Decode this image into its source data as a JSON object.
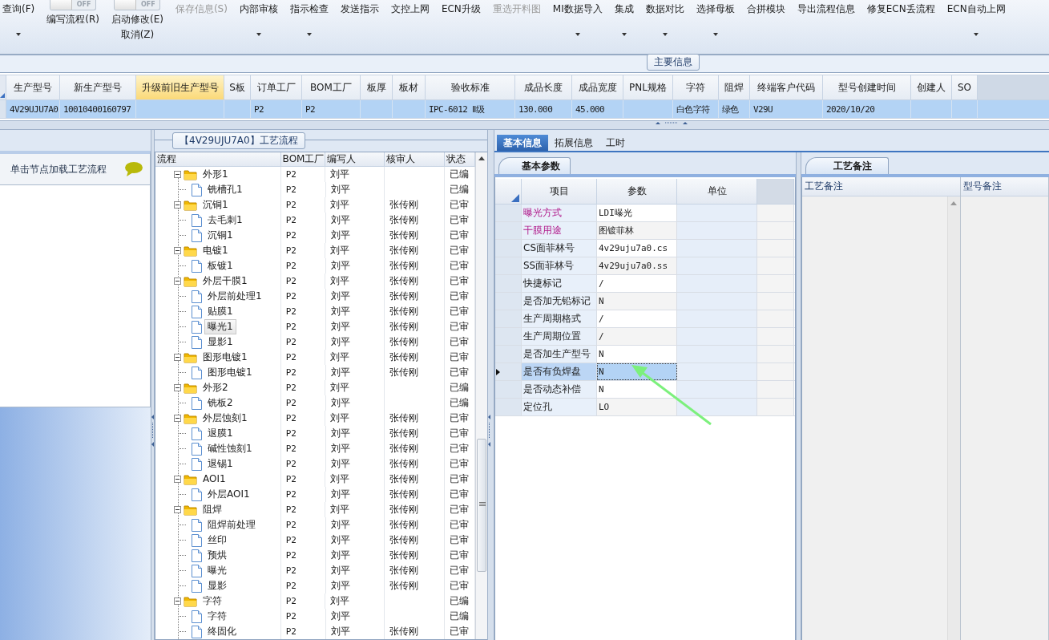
{
  "toolbar": [
    {
      "kind": "button",
      "label": "查询(F)",
      "dropdown": true,
      "disabled": false
    },
    {
      "kind": "toggle",
      "label": "编写流程(R)",
      "switch": "OFF",
      "on": false
    },
    {
      "kind": "toggle",
      "label": "启动修改(E)",
      "sublabel": "取消(Z)",
      "switch": "OFF",
      "on": false
    },
    {
      "kind": "button",
      "label": "保存信息(S)",
      "dropdown": false,
      "disabled": true
    },
    {
      "kind": "button",
      "label": "内部审核",
      "dropdown": true,
      "disabled": false
    },
    {
      "kind": "button",
      "label": "指示检查",
      "dropdown": true,
      "disabled": false
    },
    {
      "kind": "button",
      "label": "发送指示",
      "dropdown": false,
      "disabled": false
    },
    {
      "kind": "button",
      "label": "文控上网",
      "dropdown": false,
      "disabled": false
    },
    {
      "kind": "button",
      "label": "ECN升级",
      "dropdown": false,
      "disabled": false
    },
    {
      "kind": "button",
      "label": "重选开料图",
      "dropdown": false,
      "disabled": true
    },
    {
      "kind": "button",
      "label": "MI数据导入",
      "dropdown": true,
      "disabled": false
    },
    {
      "kind": "button",
      "label": "集成",
      "dropdown": true,
      "disabled": false
    },
    {
      "kind": "button",
      "label": "数据对比",
      "dropdown": true,
      "disabled": false
    },
    {
      "kind": "button",
      "label": "选择母板",
      "dropdown": true,
      "disabled": false
    },
    {
      "kind": "button",
      "label": "合拼模块",
      "dropdown": false,
      "disabled": false
    },
    {
      "kind": "button",
      "label": "导出流程信息",
      "dropdown": false,
      "disabled": false
    },
    {
      "kind": "button",
      "label": "修复ECN丢流程",
      "dropdown": false,
      "disabled": false
    },
    {
      "kind": "button",
      "label": "ECN自动上网",
      "dropdown": true,
      "disabled": false
    }
  ],
  "main_info": {
    "title": "主要信息",
    "columns": [
      {
        "label": "生产型号",
        "highlighted": false
      },
      {
        "label": "新生产型号",
        "highlighted": false
      },
      {
        "label": "升级前旧生产型号",
        "highlighted": true
      },
      {
        "label": "S板",
        "highlighted": false
      },
      {
        "label": "订单工厂",
        "highlighted": false
      },
      {
        "label": "BOM工厂",
        "highlighted": false
      },
      {
        "label": "板厚",
        "highlighted": false
      },
      {
        "label": "板材",
        "highlighted": false
      },
      {
        "label": "验收标准",
        "highlighted": false
      },
      {
        "label": "成品长度",
        "highlighted": false
      },
      {
        "label": "成品宽度",
        "highlighted": false
      },
      {
        "label": "PNL规格",
        "highlighted": false
      },
      {
        "label": "字符",
        "highlighted": false
      },
      {
        "label": "阻焊",
        "highlighted": false
      },
      {
        "label": "终端客户代码",
        "highlighted": false
      },
      {
        "label": "型号创建时间",
        "highlighted": false
      },
      {
        "label": "创建人",
        "highlighted": false
      },
      {
        "label": "SO",
        "highlighted": false
      }
    ],
    "rows": [
      {
        "selected": true,
        "cells": [
          "4V29UJU7A0",
          "10010400160797",
          null,
          null,
          "P2",
          "P2",
          null,
          null,
          "IPC-6012 Ⅱ级",
          "130.000",
          "45.000",
          null,
          "白色字符",
          "绿色",
          "V29U",
          "2020/10/20",
          null,
          null
        ]
      }
    ]
  },
  "process_flow": {
    "title": "【4V29UJU7A0】工艺流程",
    "hint": "单击节点加载工艺流程",
    "columns": [
      "流程",
      "BOM工厂",
      "编写人",
      "核审人",
      "状态"
    ],
    "nodes": [
      {
        "name": "外形1",
        "bom_factory": "P2",
        "writer": "刘平",
        "status": "已编",
        "expanded": true,
        "selected": false,
        "children": [
          {
            "name": "铣槽孔1",
            "bom_factory": "P2",
            "writer": "刘平",
            "status": "已编",
            "selected": false
          }
        ]
      },
      {
        "name": "沉铜1",
        "bom_factory": "P2",
        "writer": "刘平",
        "reviewer": "张传刚",
        "status": "已审",
        "expanded": true,
        "selected": false,
        "children": [
          {
            "name": "去毛刺1",
            "bom_factory": "P2",
            "writer": "刘平",
            "reviewer": "张传刚",
            "status": "已审",
            "selected": false
          },
          {
            "name": "沉铜1",
            "bom_factory": "P2",
            "writer": "刘平",
            "reviewer": "张传刚",
            "status": "已审",
            "selected": false
          }
        ]
      },
      {
        "name": "电镀1",
        "bom_factory": "P2",
        "writer": "刘平",
        "reviewer": "张传刚",
        "status": "已审",
        "expanded": true,
        "selected": false,
        "children": [
          {
            "name": "板镀1",
            "bom_factory": "P2",
            "writer": "刘平",
            "reviewer": "张传刚",
            "status": "已审",
            "selected": false
          }
        ]
      },
      {
        "name": "外层干膜1",
        "bom_factory": "P2",
        "writer": "刘平",
        "reviewer": "张传刚",
        "status": "已审",
        "expanded": true,
        "selected": false,
        "children": [
          {
            "name": "外层前处理1",
            "bom_factory": "P2",
            "writer": "刘平",
            "reviewer": "张传刚",
            "status": "已审",
            "selected": false
          },
          {
            "name": "贴膜1",
            "bom_factory": "P2",
            "writer": "刘平",
            "reviewer": "张传刚",
            "status": "已审",
            "selected": false
          },
          {
            "name": "曝光1",
            "bom_factory": "P2",
            "writer": "刘平",
            "reviewer": "张传刚",
            "status": "已审",
            "selected": true
          },
          {
            "name": "显影1",
            "bom_factory": "P2",
            "writer": "刘平",
            "reviewer": "张传刚",
            "status": "已审",
            "selected": false
          }
        ]
      },
      {
        "name": "图形电镀1",
        "bom_factory": "P2",
        "writer": "刘平",
        "reviewer": "张传刚",
        "status": "已审",
        "expanded": true,
        "selected": false,
        "children": [
          {
            "name": "图形电镀1",
            "bom_factory": "P2",
            "writer": "刘平",
            "reviewer": "张传刚",
            "status": "已审",
            "selected": false
          }
        ]
      },
      {
        "name": "外形2",
        "bom_factory": "P2",
        "writer": "刘平",
        "status": "已编",
        "expanded": true,
        "selected": false,
        "children": [
          {
            "name": "铣板2",
            "bom_factory": "P2",
            "writer": "刘平",
            "status": "已编",
            "selected": false
          }
        ]
      },
      {
        "name": "外层蚀刻1",
        "bom_factory": "P2",
        "writer": "刘平",
        "reviewer": "张传刚",
        "status": "已审",
        "expanded": true,
        "selected": false,
        "children": [
          {
            "name": "退膜1",
            "bom_factory": "P2",
            "writer": "刘平",
            "reviewer": "张传刚",
            "status": "已审",
            "selected": false
          },
          {
            "name": "碱性蚀刻1",
            "bom_factory": "P2",
            "writer": "刘平",
            "reviewer": "张传刚",
            "status": "已审",
            "selected": false
          },
          {
            "name": "退锡1",
            "bom_factory": "P2",
            "writer": "刘平",
            "reviewer": "张传刚",
            "status": "已审",
            "selected": false
          }
        ]
      },
      {
        "name": "AOI1",
        "bom_factory": "P2",
        "writer": "刘平",
        "reviewer": "张传刚",
        "status": "已审",
        "expanded": true,
        "selected": false,
        "children": [
          {
            "name": "外层AOI1",
            "bom_factory": "P2",
            "writer": "刘平",
            "reviewer": "张传刚",
            "status": "已审",
            "selected": false
          }
        ]
      },
      {
        "name": "阻焊",
        "bom_factory": "P2",
        "writer": "刘平",
        "reviewer": "张传刚",
        "status": "已审",
        "expanded": true,
        "selected": false,
        "children": [
          {
            "name": "阻焊前处理",
            "bom_factory": "P2",
            "writer": "刘平",
            "reviewer": "张传刚",
            "status": "已审",
            "selected": false
          },
          {
            "name": "丝印",
            "bom_factory": "P2",
            "writer": "刘平",
            "reviewer": "张传刚",
            "status": "已审",
            "selected": false
          },
          {
            "name": "预烘",
            "bom_factory": "P2",
            "writer": "刘平",
            "reviewer": "张传刚",
            "status": "已审",
            "selected": false
          },
          {
            "name": "曝光",
            "bom_factory": "P2",
            "writer": "刘平",
            "reviewer": "张传刚",
            "status": "已审",
            "selected": false
          },
          {
            "name": "显影",
            "bom_factory": "P2",
            "writer": "刘平",
            "reviewer": "张传刚",
            "status": "已审",
            "selected": false
          }
        ]
      },
      {
        "name": "字符",
        "bom_factory": "P2",
        "writer": "刘平",
        "status": "已编",
        "expanded": true,
        "selected": false,
        "children": [
          {
            "name": "字符",
            "bom_factory": "P2",
            "writer": "刘平",
            "status": "已编",
            "selected": false
          },
          {
            "name": "终固化",
            "bom_factory": "P2",
            "writer": "刘平",
            "reviewer": "张传刚",
            "status": "已审",
            "selected": false
          }
        ]
      }
    ]
  },
  "detail_tabs": [
    {
      "label": "基本信息",
      "selected": true
    },
    {
      "label": "拓展信息",
      "selected": false
    },
    {
      "label": "工时",
      "selected": false
    }
  ],
  "basic_params": {
    "title": "基本参数",
    "columns": [
      "项目",
      "参数",
      "单位"
    ],
    "rows": [
      {
        "item": "曝光方式",
        "value": "LDI曝光",
        "highlighted": true,
        "selected": false
      },
      {
        "item": "干膜用途",
        "value": "图镀菲林",
        "highlighted": true,
        "selected": false
      },
      {
        "item": "CS面菲林号",
        "value": "4v29uju7a0.cs",
        "highlighted": false,
        "selected": false
      },
      {
        "item": "SS面菲林号",
        "value": "4v29uju7a0.ss",
        "highlighted": false,
        "selected": false
      },
      {
        "item": "快捷标记",
        "value": "/",
        "highlighted": false,
        "selected": false
      },
      {
        "item": "是否加无铅标记",
        "value": "N",
        "highlighted": false,
        "selected": false
      },
      {
        "item": "生产周期格式",
        "value": "/",
        "highlighted": false,
        "selected": false
      },
      {
        "item": "生产周期位置",
        "value": "/",
        "highlighted": false,
        "selected": false
      },
      {
        "item": "是否加生产型号",
        "value": "N",
        "highlighted": false,
        "selected": false
      },
      {
        "item": "是否有负焊盘",
        "value": "N",
        "highlighted": false,
        "selected": true
      },
      {
        "item": "是否动态补偿",
        "value": "N",
        "highlighted": false,
        "selected": false
      },
      {
        "item": "定位孔",
        "value": "LO",
        "highlighted": false,
        "selected": false
      }
    ]
  },
  "remarks": {
    "title": "工艺备注",
    "columns": [
      "工艺备注",
      "型号备注"
    ]
  }
}
